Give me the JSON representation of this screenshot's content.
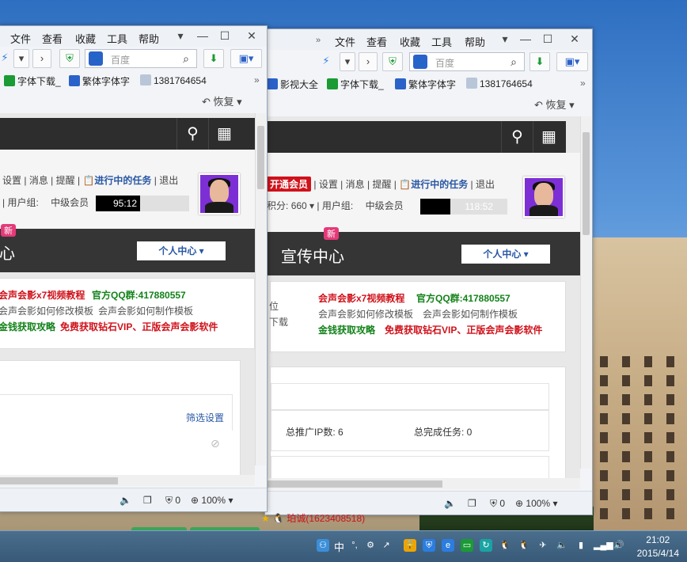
{
  "menu": {
    "file": "文件",
    "view": "查看",
    "favorites": "收藏",
    "tools": "工具",
    "help": "帮助"
  },
  "search": {
    "placeholder": "百度"
  },
  "favorites": {
    "item_video": "影视大全",
    "item_font": "字体下载_",
    "item_fan": "繁体字体字",
    "item_num": "1381764654"
  },
  "subbar": {
    "undo": "恢复"
  },
  "userbar": {
    "settings": "设置",
    "messages": "消息",
    "remind": "提醒",
    "tasks": "进行中的任务",
    "logout": "退出",
    "vip": "开通会员",
    "points_label": "积分:",
    "points": "660",
    "group_label": "用户组:",
    "group_value": "中级会员",
    "progress_w1": "95:12",
    "progress_w2": "118:52"
  },
  "darknav": {
    "w1_title": "心",
    "w2_title": "宣传中心",
    "badge": "新",
    "personal_center": "个人中心"
  },
  "notice": {
    "x7_tutorial": "会声会影x7视频教程",
    "qq_group": "官方QQ群:417880557",
    "modify_template": "会声会影如何修改模板",
    "make_template": "会声会影如何制作模板",
    "money": "金钱获取攻略",
    "free_vip": "免费获取钻石VIP、正版会声会影软件",
    "left_a": "位",
    "left_b": "下载"
  },
  "panel": {
    "filter": "筛选设置",
    "ip": "总推广IP数: 6",
    "tasks": "总完成任务: 0"
  },
  "status": {
    "shield_count": "0",
    "zoom": "100%"
  },
  "qq_user": "珀诚(1623408518)",
  "taskbar": {
    "ime": "中",
    "time": "21:02",
    "date": "2015/4/14"
  }
}
